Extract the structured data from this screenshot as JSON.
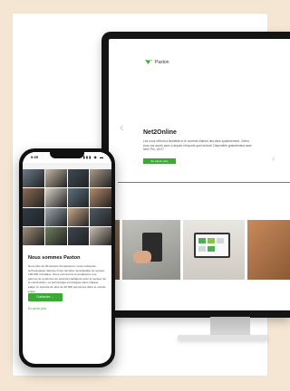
{
  "desktop": {
    "logo_text": "Paxton",
    "hero_title": "Net2Online",
    "hero_text": "Les nous offrent la flexibilité et le contrôle ultimes des sites systèmement. Gérez tous vos accès avec à depuis n'importe quel endroit. Disponible gratuitement avec Net2 Pro, v6.07",
    "hero_button": "En savoir plus",
    "arrow_left": "‹",
    "arrow_right": "›"
  },
  "phone": {
    "time": "9:35",
    "status_icons": "▮▮▮ ◉ ▬",
    "heading": "Nous sommes Paxton",
    "body": "Nous plus de 30 années d'expérience, notre entreprise technologique dispose d'une sécurité remarquable du secteur 100 000 mondiaux. Nous concevons et produisons une gamme de systèmes de sécurité intelligents pour le secteur de la construction. La technologie est intégrée dans chaque étape, le sécurité de plus de 20 000 personnes dans le monde entier.",
    "button": "Contactez →",
    "link": "En savoir plus"
  },
  "colors": {
    "brand_green": "#3aaa35",
    "background": "#f5e6d3"
  },
  "mosaic_colors": [
    "#6b7a8a",
    "#c4b7a6",
    "#3e4a57",
    "#a99c8c",
    "#8c6b55",
    "#d8d2c8",
    "#5c6f7e",
    "#b48a6a",
    "#2f3b47",
    "#9aa6ad",
    "#c7a588",
    "#4d5a63",
    "#a08d7a",
    "#6d7f5d",
    "#3b4650",
    "#cbbfb0"
  ]
}
